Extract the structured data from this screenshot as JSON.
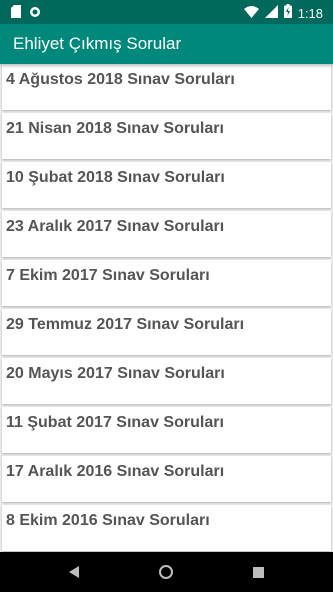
{
  "status_bar": {
    "time": "1:18",
    "icons": [
      "sd-card-icon",
      "sync-icon",
      "wifi-icon",
      "signal-icon",
      "battery-charging-icon"
    ]
  },
  "app_bar": {
    "title": "Ehliyet Çıkmış Sorular"
  },
  "items": [
    {
      "label": "4 Ağustos 2018 Sınav Soruları"
    },
    {
      "label": "21 Nisan 2018 Sınav Soruları"
    },
    {
      "label": "10 Şubat 2018 Sınav Soruları"
    },
    {
      "label": "23 Aralık 2017 Sınav Soruları"
    },
    {
      "label": "7 Ekim 2017 Sınav Soruları"
    },
    {
      "label": "29 Temmuz 2017 Sınav Soruları"
    },
    {
      "label": "20 Mayıs 2017 Sınav Soruları"
    },
    {
      "label": "11 Şubat 2017 Sınav Soruları"
    },
    {
      "label": "17 Aralık 2016 Sınav Soruları"
    },
    {
      "label": "8 Ekim 2016 Sınav Soruları"
    }
  ],
  "nav_bar": {
    "buttons": [
      "back-icon",
      "home-icon",
      "recents-icon"
    ]
  },
  "colors": {
    "status_bar": "#00695c",
    "app_bar": "#00897b",
    "background": "#eeeeee",
    "item_text": "#555555"
  }
}
